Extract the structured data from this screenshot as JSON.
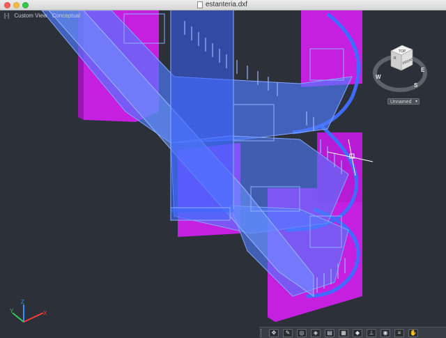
{
  "window": {
    "title": "estanteria.dxf"
  },
  "viewport_controls": {
    "menu": "[-]",
    "view": "Custom View",
    "visual_style": "Conceptual"
  },
  "viewcube": {
    "top_label": "TOP",
    "front_label": "FRONT",
    "right_label": "R",
    "compass_west": "W",
    "compass_south": "S",
    "compass_east": "E"
  },
  "coord_system": {
    "selected": "Unnamed"
  },
  "ucs": {
    "x_label": "X",
    "y_label": "Y",
    "z_label": "Z"
  },
  "toolbar": {
    "icons": [
      "grip-icon",
      "move-icon",
      "pencil-icon",
      "orbit-icon",
      "view-icon",
      "layout-icon",
      "grid-icon",
      "snap-icon",
      "ortho-icon",
      "polar-icon",
      "lineweight-icon",
      "pan-icon"
    ]
  },
  "colors": {
    "background": "#2b3039",
    "magenta": "#cc22ee",
    "blue": "#5a8cff",
    "crosshair": "#ffffff"
  }
}
